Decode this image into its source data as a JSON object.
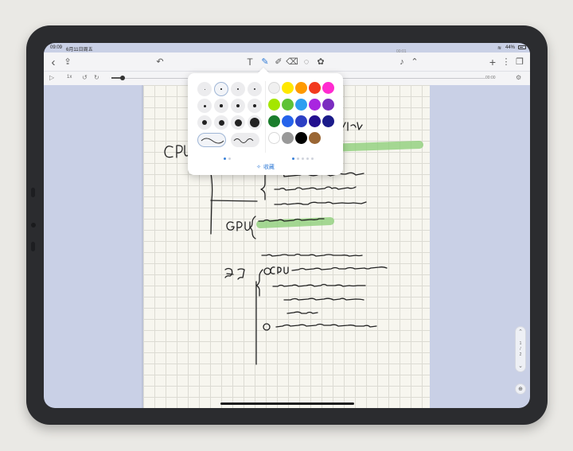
{
  "status_bar": {
    "time": "09:09",
    "date": "6月11日周五",
    "recording_time": "00:01",
    "battery": "44%"
  },
  "toolbar": {
    "icons": {
      "back": "chevron-left-icon",
      "share": "share-icon",
      "undo": "undo-icon",
      "text": "text-tool-icon",
      "pen": "pen-icon",
      "highlighter": "highlighter-icon",
      "eraser": "eraser-icon",
      "lasso": "lasso-icon",
      "shapes": "shape-icon",
      "mic": "microphone-icon",
      "add": "plus-icon",
      "more": "more-icon",
      "pages": "pages-icon"
    },
    "glyphs": {
      "back": "‹",
      "share": "⇪",
      "undo": "↶",
      "text": "T",
      "pen": "✎",
      "highlighter": "✐",
      "eraser": "⌫",
      "lasso": "◌",
      "shapes": "✿",
      "mic": "♪",
      "collapse": "⌃",
      "add": "+",
      "more": "⋮",
      "pages": "❐"
    }
  },
  "audio_bar": {
    "speed": "1x",
    "time": "00:00",
    "progress": 0.03,
    "glyphs": {
      "play": "▷",
      "rewind": "↺",
      "forward": "↻",
      "settings": "⚙"
    }
  },
  "pen_popover": {
    "favorites_label": "收藏",
    "favorites_glyph": "✧",
    "selected_size_index": 1,
    "sizes_rows": [
      [
        1,
        1.5,
        2,
        2.5
      ],
      [
        3,
        3.5,
        4,
        4.5
      ],
      [
        6,
        7,
        9,
        12
      ]
    ],
    "strokes": [
      "smooth",
      "wave"
    ],
    "colors": [
      [
        "#f0f0f0",
        "#ffe800",
        "#ff9a00",
        "#f23a1f",
        "#ff2bd0"
      ],
      [
        "#a4e600",
        "#5ec237",
        "#2e9ef0",
        "#a926e0",
        "#7b2cc0"
      ],
      [
        "#1a7d2c",
        "#2563eb",
        "#2c3fc4",
        "#23108f",
        "#1b1b8a"
      ],
      [
        "#ffffff",
        "#999999",
        "#000000",
        "#9a6634"
      ]
    ],
    "left_dots": 2,
    "left_dot_active": 0,
    "right_dots": 5,
    "right_dot_active": 0
  },
  "side_pager": {
    "current": "1",
    "total": "2",
    "up_glyph": "⌃",
    "down_glyph": "⌄",
    "zoom_glyph": "⊕"
  }
}
